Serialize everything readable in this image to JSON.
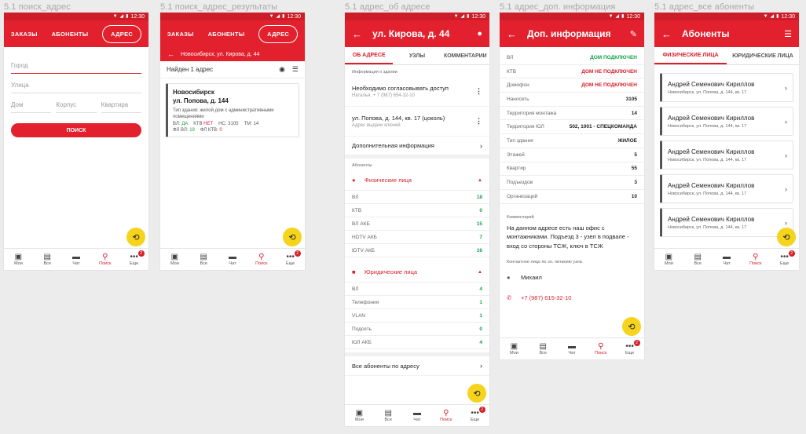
{
  "frames": {
    "f1": "5.1 поиск_адрес",
    "f2": "5.1 поиск_адрес_результаты",
    "f3": "5.1 адрес_об адресе",
    "f4": "5.1 адрес_доп. информация",
    "f5": "5.1 адрес_все абоненты"
  },
  "status": {
    "time": "12:30"
  },
  "nav": {
    "my": "Мои",
    "all": "Все",
    "chat": "Чат",
    "search": "Поиск",
    "more": "Еще",
    "badge": "2"
  },
  "s1": {
    "tab_orders": "ЗАКАЗЫ",
    "tab_subs": "АБОНЕНТЫ",
    "tab_addr": "АДРЕС",
    "ph_city": "Город",
    "ph_street": "Улица",
    "ph_house": "Дом",
    "ph_corp": "Корпус",
    "ph_flat": "Квартира",
    "search_btn": "ПОИСК"
  },
  "s2": {
    "subheader": "Новосибирск, ул. Кирова, д. 44",
    "found": "Найден 1 адрес",
    "city": "Новосибирск",
    "street": "ул. Попова, д. 144",
    "type": "Тип здания: жилой дом с административными помещениями",
    "vl": "ВЛ:",
    "vl_v": "ДА",
    "ktv": "КТВ",
    "ktv_v": "НЕТ",
    "hs": "НС: 3105",
    "tm": "ТМ: 14",
    "fl_vl": "ФЛ ВЛ:",
    "fl_vl_v": "19",
    "fl_ktv": "ФЛ КТВ:",
    "fl_ktv_v": "0"
  },
  "s3": {
    "title": "ул. Кирова, д. 44",
    "tab1": "ОБ АДРЕСЕ",
    "tab2": "УЗЛЫ",
    "tab3": "КОММЕНТАРИИ",
    "sec_info": "Информация о здании",
    "item1": "Необходимо согласовывать доступ",
    "item1_sub": "Наталья, + 7 (987) 654-32-10",
    "item2": "ул. Попова, д. 144, кв. 17 (цоколь)",
    "item2_sub": "Адрес выдачи ключей",
    "item3": "Дополнительная информация",
    "sec_subs": "Абоненты",
    "phys": "Физические лица",
    "phys_rows": [
      {
        "k": "ВЛ",
        "v": "18"
      },
      {
        "k": "КТВ",
        "v": "0"
      },
      {
        "k": "ВЛ АКБ",
        "v": "15"
      },
      {
        "k": "HDTV АКБ",
        "v": "7"
      },
      {
        "k": "IDTV АКБ",
        "v": "16"
      }
    ],
    "jur": "Юридические лица",
    "jur_rows": [
      {
        "k": "ВЛ",
        "v": "4"
      },
      {
        "k": "Телефония",
        "v": "1"
      },
      {
        "k": "VLAN",
        "v": "1"
      },
      {
        "k": "Подсеть",
        "v": "0"
      },
      {
        "k": "ЮЛ АКБ",
        "v": "4"
      }
    ],
    "all_subs": "Все абоненты по адресу"
  },
  "s4": {
    "title": "Доп. информация",
    "rows": [
      {
        "k": "ВЛ",
        "v": "ДОМ ПОДКЛЮЧЕН",
        "c": "g"
      },
      {
        "k": "КТВ",
        "v": "ДОМ НЕ ПОДКЛЮЧЕН",
        "c": "r"
      },
      {
        "k": "Домофон",
        "v": "ДОМ НЕ ПОДКЛЮЧЕН",
        "c": "r"
      },
      {
        "k": "Наносеть",
        "v": "3105",
        "c": ""
      },
      {
        "k": "Территория монтажа",
        "v": "14",
        "c": ""
      },
      {
        "k": "Территория ЮЛ",
        "v": "502, 1001 - СПЕЦКОМАНДА",
        "c": ""
      },
      {
        "k": "Тип здания",
        "v": "ЖИЛОЕ",
        "c": ""
      },
      {
        "k": "Этажей",
        "v": "5",
        "c": ""
      },
      {
        "k": "Квартир",
        "v": "55",
        "c": ""
      },
      {
        "k": "Подъездов",
        "v": "3",
        "c": ""
      },
      {
        "k": "Организаций",
        "v": "10",
        "c": ""
      }
    ],
    "comment_label": "Комментарий",
    "comment": "На данном адресе есть наш офис с монтажниками. Подъезд 3 - узел в подвале - вход со стороны ТСЖ, ключ в ТСЖ",
    "contact_label": "Контактное лицо по эл. питанию узла",
    "contact_name": "Михаил",
    "contact_phone": "+7 (987) 615-32-10"
  },
  "s5": {
    "title": "Абоненты",
    "tab1": "ФИЗИЧЕСКИЕ ЛИЦА",
    "tab2": "ЮРИДИЧЕСКИЕ ЛИЦА",
    "items": [
      {
        "name": "Андрей Семенович Кириллов",
        "addr": "Новосибирск, ул. Попова, д. 144, кв. 17"
      },
      {
        "name": "Андрей Семенович Кириллов",
        "addr": "Новосибирск, ул. Попова, д. 144, кв. 17"
      },
      {
        "name": "Андрей Семенович Кириллов",
        "addr": "Новосибирск, ул. Попова, д. 144, кв. 17"
      },
      {
        "name": "Андрей Семенович Кириллов",
        "addr": "Новосибирск, ул. Попова, д. 144, кв. 17"
      },
      {
        "name": "Андрей Семенович Кириллов",
        "addr": "Новосибирск, ул. Попова, д. 144, кв. 17"
      }
    ]
  }
}
